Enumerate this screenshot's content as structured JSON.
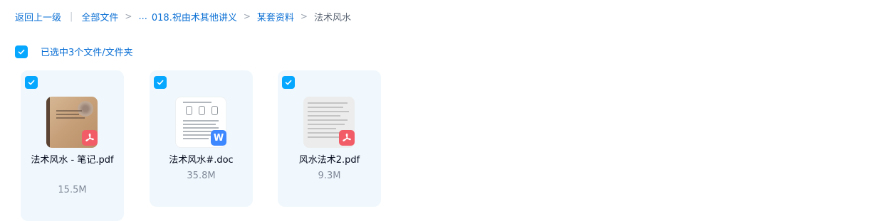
{
  "breadcrumb": {
    "back": "返回上一级",
    "all_files": "全部文件",
    "ellipsis": "...",
    "items": [
      "018.祝由术其他讲义",
      "某套资料"
    ],
    "current": "法术风水",
    "separator": ">"
  },
  "selection": {
    "label": "已选中3个文件/文件夹",
    "checked": true
  },
  "files": [
    {
      "name": "法术风水 - 笔记.pdf",
      "size": "15.5M",
      "type": "pdf",
      "checked": true,
      "thumbnail": "notebook-cover"
    },
    {
      "name": "法术风水#.doc",
      "size": "35.8M",
      "type": "word",
      "badge_letter": "W",
      "checked": true,
      "thumbnail": "document-page"
    },
    {
      "name": "风水法术2.pdf",
      "size": "9.3M",
      "type": "pdf",
      "checked": true,
      "thumbnail": "scanned-page"
    }
  ],
  "colors": {
    "accent": "#06a7ff",
    "link": "#0a6fd4",
    "card_bg": "#f0f8fd",
    "pdf_badge": "#f25c67",
    "word_badge": "#3d87ff"
  }
}
